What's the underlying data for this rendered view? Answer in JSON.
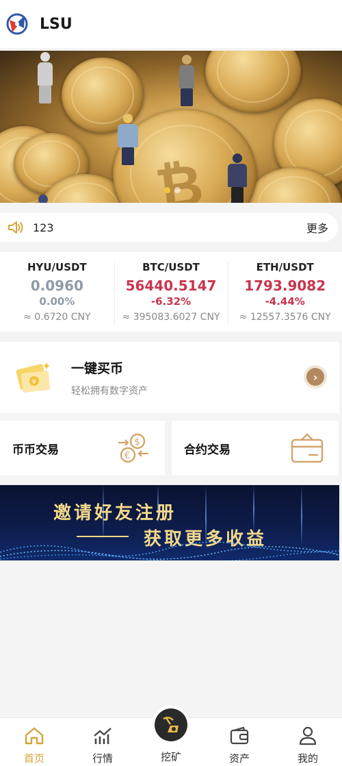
{
  "header": {
    "title": "LSU",
    "logo_icon": "lsu-logo-icon"
  },
  "banner": {
    "slides": 2,
    "active_slide": 1
  },
  "notice": {
    "text": "123",
    "more_label": "更多"
  },
  "tickers": [
    {
      "pair": "HYU/USDT",
      "price": "0.0960",
      "change": "0.00%",
      "cny": "≈ 0.6720 CNY",
      "trend": "neutral"
    },
    {
      "pair": "BTC/USDT",
      "price": "56440.5147",
      "change": "-6.32%",
      "cny": "≈ 395083.6027 CNY",
      "trend": "down"
    },
    {
      "pair": "ETH/USDT",
      "price": "1793.9082",
      "change": "-4.44%",
      "cny": "≈ 12557.3576 CNY",
      "trend": "down"
    }
  ],
  "buy": {
    "title": "一键买币",
    "subtitle": "轻松拥有数字资产"
  },
  "trades": {
    "spot_label": "币币交易",
    "contract_label": "合约交易"
  },
  "invite": {
    "line1": "邀请好友注册",
    "line2": "获取更多收益"
  },
  "tabbar": {
    "items": [
      {
        "label": "首页",
        "icon": "home-icon",
        "active": true
      },
      {
        "label": "行情",
        "icon": "chart-icon",
        "active": false
      },
      {
        "label": "挖矿",
        "icon": "mining-icon",
        "active": false
      },
      {
        "label": "资产",
        "icon": "wallet-icon",
        "active": false
      },
      {
        "label": "我的",
        "icon": "user-icon",
        "active": false
      }
    ]
  },
  "colors": {
    "accent": "#d5a439",
    "down": "#c9354d",
    "neutral": "#8e9ba8"
  }
}
